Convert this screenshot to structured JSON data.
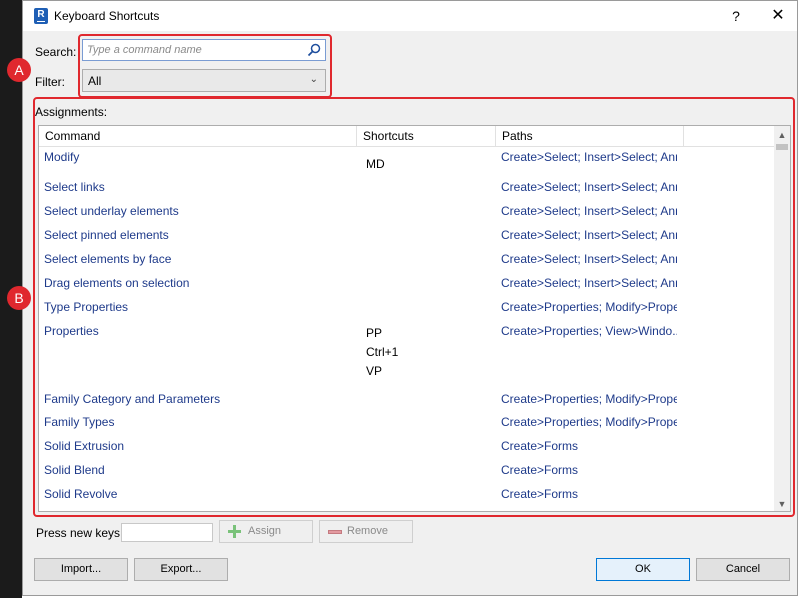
{
  "window": {
    "title": "Keyboard Shortcuts",
    "help": "?",
    "close": "✕",
    "icon_letter": "R"
  },
  "search": {
    "label": "Search:",
    "placeholder": "Type a command name",
    "value": ""
  },
  "filter": {
    "label": "Filter:",
    "value": "All"
  },
  "assignments": {
    "label": "Assignments:",
    "columns": [
      "Command",
      "Shortcuts",
      "Paths"
    ],
    "rows": [
      {
        "command": "Modify",
        "shortcuts": [
          "MD"
        ],
        "paths": "Create>Select; Insert>Select; Ann..."
      },
      {
        "command": "Select links",
        "shortcuts": [],
        "paths": "Create>Select; Insert>Select; Ann..."
      },
      {
        "command": "Select underlay elements",
        "shortcuts": [],
        "paths": "Create>Select; Insert>Select; Ann..."
      },
      {
        "command": "Select pinned elements",
        "shortcuts": [],
        "paths": "Create>Select; Insert>Select; Ann..."
      },
      {
        "command": "Select elements by face",
        "shortcuts": [],
        "paths": "Create>Select; Insert>Select; Ann..."
      },
      {
        "command": "Drag elements on selection",
        "shortcuts": [],
        "paths": "Create>Select; Insert>Select; Ann..."
      },
      {
        "command": "Type Properties",
        "shortcuts": [],
        "paths": "Create>Properties; Modify>Prope..."
      },
      {
        "command": "Properties",
        "shortcuts": [
          "PP",
          "Ctrl+1",
          "VP"
        ],
        "paths": "Create>Properties; View>Windo..."
      },
      {
        "command": "Family Category and Parameters",
        "shortcuts": [],
        "paths": "Create>Properties; Modify>Prope..."
      },
      {
        "command": "Family Types",
        "shortcuts": [],
        "paths": "Create>Properties; Modify>Prope..."
      },
      {
        "command": "Solid Extrusion",
        "shortcuts": [],
        "paths": "Create>Forms"
      },
      {
        "command": "Solid Blend",
        "shortcuts": [],
        "paths": "Create>Forms"
      },
      {
        "command": "Solid Revolve",
        "shortcuts": [],
        "paths": "Create>Forms"
      }
    ]
  },
  "keys": {
    "label": "Press new keys:",
    "value": "",
    "assign": "Assign",
    "remove": "Remove"
  },
  "footer": {
    "import": "Import...",
    "export": "Export...",
    "ok": "OK",
    "cancel": "Cancel"
  },
  "callouts": {
    "a": "A",
    "b": "B"
  },
  "colors": {
    "callout": "#e0282e",
    "link_text": "#1e3a8a"
  },
  "icons": {
    "search": "magnifier-icon",
    "assign": "plus-icon",
    "remove": "minus-icon",
    "filter": "chevron-down-icon"
  }
}
